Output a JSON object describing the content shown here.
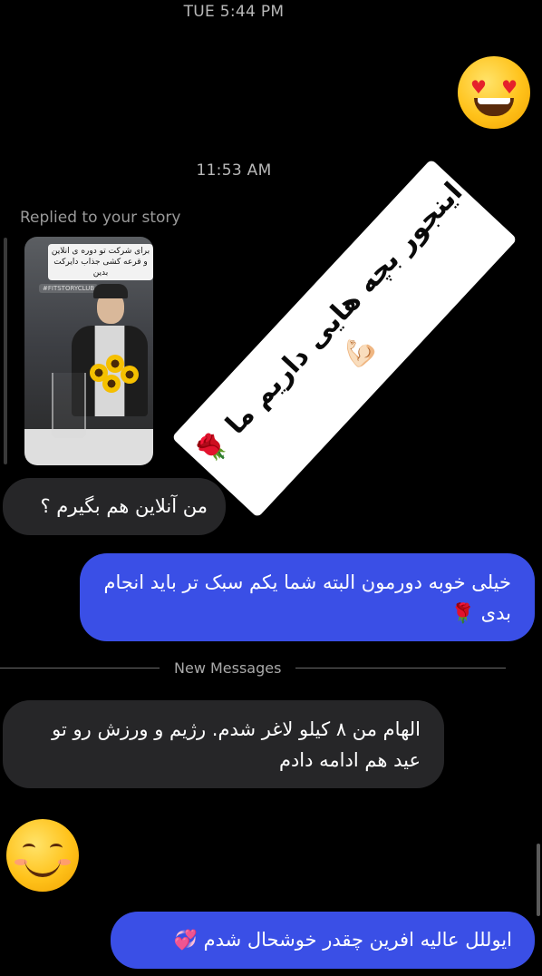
{
  "timestamps": {
    "top": "TUE 5:44 PM",
    "middle": "11:53 AM"
  },
  "reactions": {
    "top_emoji": "heart-eyes-face",
    "bottom_emoji": "smiling-face-with-smiling-eyes"
  },
  "story_reply": {
    "label": "Replied to your story",
    "thumbnail": {
      "caption": "برای شرکت تو دوره ی انلاین و قرعه کشی جذاب دایرکت بدین",
      "tag": "#FITSTORYCLUB"
    },
    "sticker_text": "اینجور بچه هایی داریم ما 🌹\n💪🏻",
    "sticker_lines": [
      "اینجور بچه هایی داریم ما 🌹",
      "💪🏻"
    ]
  },
  "messages": [
    {
      "direction": "incoming",
      "text": "من آنلاین هم بگیرم ؟"
    },
    {
      "direction": "outgoing",
      "text": "خیلی خوبه دورمون البته شما یکم سبک تر باید انجام بدی 🌹"
    },
    {
      "direction": "incoming",
      "text": "الهام من ۸ کیلو لاغر شدم. رژیم و ورزش رو تو عید هم ادامه دادم"
    },
    {
      "direction": "outgoing",
      "text": "ایوللل عالیه افرین چقدر خوشحال شدم 💞"
    }
  ],
  "divider": {
    "label": "New Messages"
  },
  "colors": {
    "background": "#000000",
    "incoming_bubble": "#262628",
    "outgoing_bubble": "#3a4fe6",
    "muted_text": "#9a9a9a"
  }
}
